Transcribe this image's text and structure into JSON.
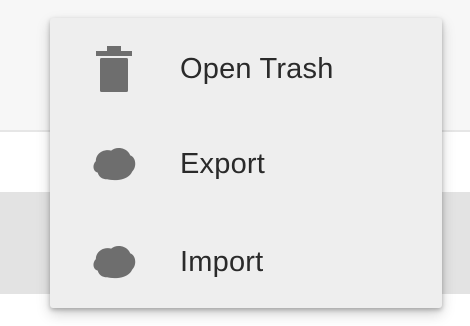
{
  "menu": {
    "items": [
      {
        "label": "Open Trash",
        "icon": "trash-icon"
      },
      {
        "label": "Export",
        "icon": "cloud-icon"
      },
      {
        "label": "Import",
        "icon": "cloud-icon"
      }
    ]
  },
  "colors": {
    "menu_background": "#eeeeee",
    "icon": "#6e6e6e",
    "text": "#2a2a2a"
  }
}
